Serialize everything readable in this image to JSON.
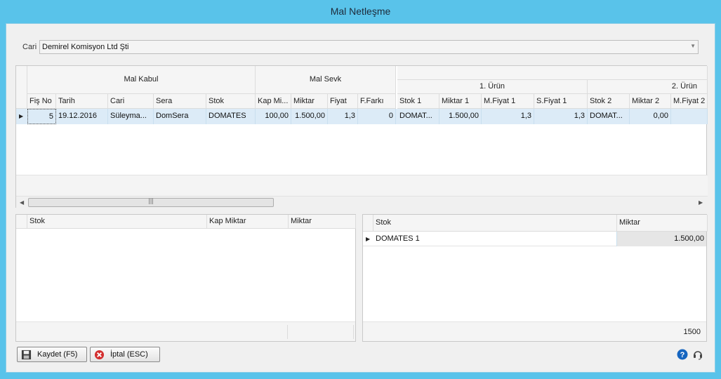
{
  "window": {
    "title": "Mal Netleşme"
  },
  "cari": {
    "label": "Cari",
    "value": "Demirel Komisyon Ltd Şti"
  },
  "main_grid": {
    "bands": {
      "mal_kabul": "Mal Kabul",
      "mal_sevk": "Mal Sevk",
      "urun1": "1. Ürün",
      "urun2": "2. Ürün"
    },
    "columns": [
      "Fiş No",
      "Tarih",
      "Cari",
      "Sera",
      "Stok",
      "Kap Mi...",
      "Miktar",
      "Fiyat",
      "F.Farkı",
      "Stok 1",
      "Miktar 1",
      "M.Fiyat 1",
      "S.Fiyat 1",
      "Stok 2",
      "Miktar 2",
      "M.Fiyat 2"
    ],
    "row": [
      "5",
      "19.12.2016",
      "Süleyma...",
      "DomSera",
      "DOMATES",
      "100,00",
      "1.500,00",
      "1,3",
      "0",
      "DOMAT...",
      "1.500,00",
      "1,3",
      "1,3",
      "DOMAT...",
      "0,00",
      ""
    ]
  },
  "left_grid": {
    "columns": [
      "Stok",
      "Kap Miktar",
      "Miktar"
    ]
  },
  "right_grid": {
    "columns": [
      "Stok",
      "Miktar"
    ],
    "row": {
      "stok": "DOMATES 1",
      "miktar": "1.500,00"
    },
    "footer_total": "1500"
  },
  "buttons": {
    "save": "Kaydet (F5)",
    "cancel": "İptal (ESC)"
  },
  "icons": [
    "save-icon",
    "cancel-icon",
    "help-icon",
    "support-headset-icon"
  ],
  "colors": {
    "title_bar": "#59c3ea",
    "selected_row": "#dcebf7",
    "help": "#1565c0",
    "cancel": "#d32f2f"
  }
}
